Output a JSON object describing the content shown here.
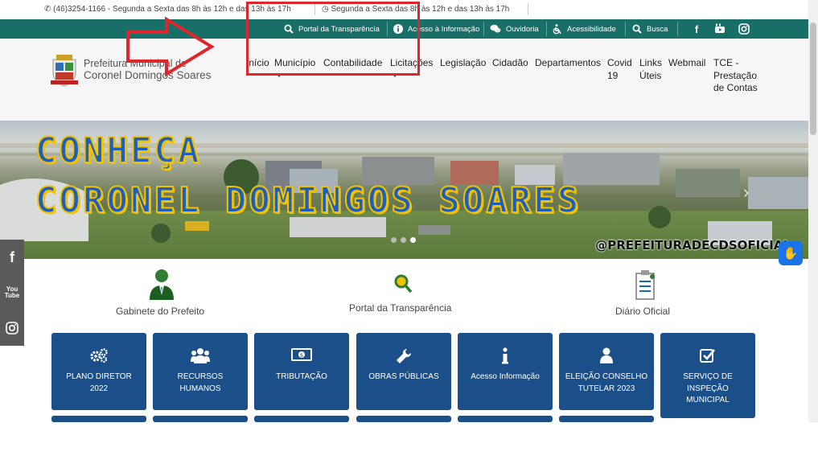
{
  "top_info": {
    "phone": "(46)3254-1166 - Segunda a Sexta das 8h às 12h e das 13h às 17h",
    "hours": "Segunda a Sexta das 8h às 12h e das 13h às 17h"
  },
  "utility_bar": {
    "portal_transparencia": "Portal da Transparência",
    "acesso_informacao": "Acesso à Informação",
    "ouvidoria": "Ouvidoria",
    "acessibilidade": "Acessibilidade",
    "busca": "Busca",
    "bg_color": "#186f68"
  },
  "brand": {
    "line1": "Prefeitura Municipal de",
    "line2": "Coronel Domingos Soares"
  },
  "nav": {
    "inicio": "Início",
    "municipio": "Município",
    "contabilidade": "Contabilidade",
    "licitacoes": "Licitações",
    "legislacao": "Legislação",
    "cidadao": "Cidadão",
    "departamentos": "Departamentos",
    "covid": "Covid 19",
    "links": "Links Úteis",
    "webmail": "Webmail",
    "tce": "TCE - Prestação de Contas"
  },
  "banner": {
    "line1": "CONHEÇA",
    "line2": "CORONEL DOMINGOS SOARES",
    "handle": "@PREFEITURADECDSOFICIAL"
  },
  "side_social": {
    "facebook": "f",
    "youtube": "You Tube",
    "instagram": "instagram-icon"
  },
  "quick_links": {
    "gabinete": "Gabinete do Prefeito",
    "portal": "Portal da Transparência",
    "diario": "Diário Oficial"
  },
  "tiles": [
    {
      "label": "PLANO DIRETOR 2022",
      "icon": "gears-icon"
    },
    {
      "label": "RECURSOS HUMANOS",
      "icon": "users-icon"
    },
    {
      "label": "TRIBUTAÇÃO",
      "icon": "money-icon"
    },
    {
      "label": "OBRAS PÚBLICAS",
      "icon": "wrench-icon"
    },
    {
      "label": "Acesso Informação",
      "icon": "info-icon"
    },
    {
      "label": "ELEIÇÃO CONSELHO TUTELAR 2023",
      "icon": "user-icon"
    },
    {
      "label": "SERVIÇO DE INSPEÇÃO MUNICIPAL",
      "icon": "check-icon"
    }
  ],
  "colors": {
    "tile": "#1b4f8a",
    "annotation": "#e0262a"
  }
}
